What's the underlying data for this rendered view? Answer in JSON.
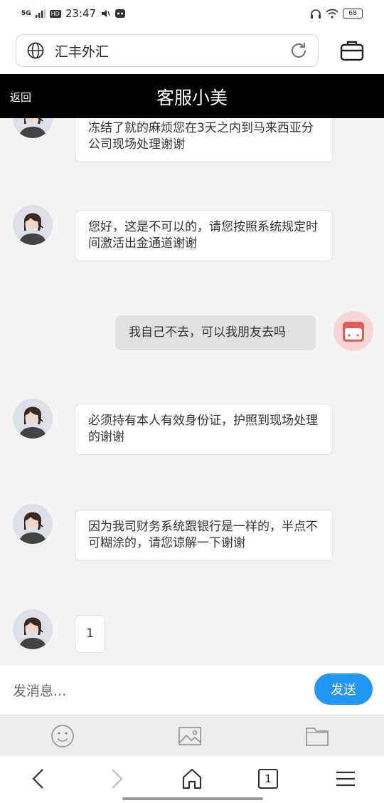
{
  "status": {
    "signal": "5G",
    "hd": "HD",
    "time": "23:47",
    "battery": "68"
  },
  "browser": {
    "url": "汇丰外汇"
  },
  "header": {
    "back": "返回",
    "title": "客服小美"
  },
  "messages": [
    {
      "from": "agent",
      "text": "冻结了就的麻烦您在3天之内到马来西亚分公司现场处理谢谢"
    },
    {
      "from": "agent",
      "text": "您好，这是不可以的，请您按照系统规定时间激活出金通道谢谢"
    },
    {
      "from": "user",
      "text": "我自己不去，可以我朋友去吗"
    },
    {
      "from": "agent",
      "text": "必须持有本人有效身份证，护照到现场处理的谢谢"
    },
    {
      "from": "agent",
      "text": "因为我司财务系统跟银行是一样的，半点不可糊涂的，请您谅解一下谢谢"
    },
    {
      "from": "agent",
      "text": "1"
    }
  ],
  "input": {
    "placeholder": "发消息...",
    "send": "发送"
  },
  "nav": {
    "tabs": "1"
  }
}
